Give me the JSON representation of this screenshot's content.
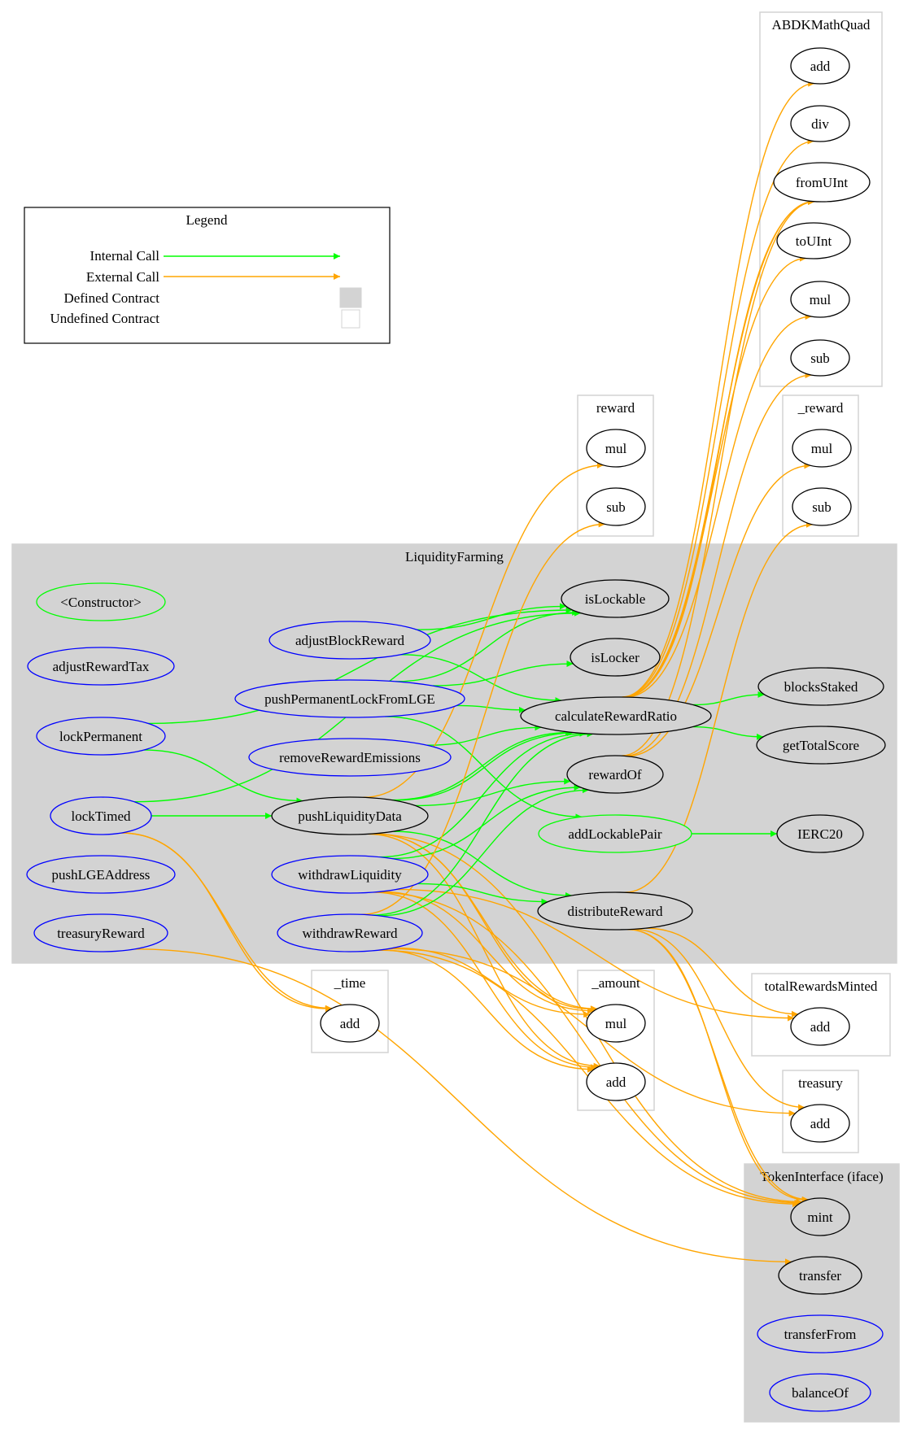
{
  "legend": {
    "title": "Legend",
    "items": [
      {
        "label": "Internal Call",
        "kind": "edge",
        "color": "#00ff00"
      },
      {
        "label": "External Call",
        "kind": "edge",
        "color": "#ffa500"
      },
      {
        "label": "Defined Contract",
        "kind": "swatch",
        "color": "#d3d3d3"
      },
      {
        "label": "Undefined Contract",
        "kind": "swatch",
        "color": "#ffffff"
      }
    ]
  },
  "colors": {
    "internal": "#00ff00",
    "external": "#ffa500",
    "defined_fill": "#d3d3d3",
    "undefined_border": "#d3d3d3",
    "public_node": "#0000ff",
    "internal_node": "#00ff00",
    "plain_node": "#000000"
  },
  "clusters": [
    {
      "id": "ABDKMathQuad",
      "label": "ABDKMathQuad",
      "defined": false
    },
    {
      "id": "reward",
      "label": "reward",
      "defined": false
    },
    {
      "id": "_reward",
      "label": "_reward",
      "defined": false
    },
    {
      "id": "LiquidityFarming",
      "label": "LiquidityFarming",
      "defined": true
    },
    {
      "id": "_time",
      "label": "_time",
      "defined": false
    },
    {
      "id": "_amount",
      "label": "_amount",
      "defined": false
    },
    {
      "id": "totalRewardsMinted",
      "label": "totalRewardsMinted",
      "defined": false
    },
    {
      "id": "treasury",
      "label": "treasury",
      "defined": false
    },
    {
      "id": "TokenInterface",
      "label": "TokenInterface  (iface)",
      "defined": true
    }
  ],
  "nodes": [
    {
      "id": "abdk_add",
      "label": "add",
      "cluster": "ABDKMathQuad",
      "style": "plain"
    },
    {
      "id": "abdk_div",
      "label": "div",
      "cluster": "ABDKMathQuad",
      "style": "plain"
    },
    {
      "id": "abdk_fromUInt",
      "label": "fromUInt",
      "cluster": "ABDKMathQuad",
      "style": "plain"
    },
    {
      "id": "abdk_toUInt",
      "label": "toUInt",
      "cluster": "ABDKMathQuad",
      "style": "plain"
    },
    {
      "id": "abdk_mul",
      "label": "mul",
      "cluster": "ABDKMathQuad",
      "style": "plain"
    },
    {
      "id": "abdk_sub",
      "label": "sub",
      "cluster": "ABDKMathQuad",
      "style": "plain"
    },
    {
      "id": "reward_mul",
      "label": "mul",
      "cluster": "reward",
      "style": "plain"
    },
    {
      "id": "reward_sub",
      "label": "sub",
      "cluster": "reward",
      "style": "plain"
    },
    {
      "id": "_reward_mul",
      "label": "mul",
      "cluster": "_reward",
      "style": "plain"
    },
    {
      "id": "_reward_sub",
      "label": "sub",
      "cluster": "_reward",
      "style": "plain"
    },
    {
      "id": "constructor",
      "label": "<Constructor>",
      "cluster": "LiquidityFarming",
      "style": "internal"
    },
    {
      "id": "adjustRewardTax",
      "label": "adjustRewardTax",
      "cluster": "LiquidityFarming",
      "style": "public"
    },
    {
      "id": "lockPermanent",
      "label": "lockPermanent",
      "cluster": "LiquidityFarming",
      "style": "public"
    },
    {
      "id": "lockTimed",
      "label": "lockTimed",
      "cluster": "LiquidityFarming",
      "style": "public"
    },
    {
      "id": "pushLGEAddress",
      "label": "pushLGEAddress",
      "cluster": "LiquidityFarming",
      "style": "public"
    },
    {
      "id": "treasuryReward",
      "label": "treasuryReward",
      "cluster": "LiquidityFarming",
      "style": "public"
    },
    {
      "id": "adjustBlockReward",
      "label": "adjustBlockReward",
      "cluster": "LiquidityFarming",
      "style": "public"
    },
    {
      "id": "pushPermanentLockFromLGE",
      "label": "pushPermanentLockFromLGE",
      "cluster": "LiquidityFarming",
      "style": "public"
    },
    {
      "id": "removeRewardEmissions",
      "label": "removeRewardEmissions",
      "cluster": "LiquidityFarming",
      "style": "public"
    },
    {
      "id": "pushLiquidityData",
      "label": "pushLiquidityData",
      "cluster": "LiquidityFarming",
      "style": "plain"
    },
    {
      "id": "withdrawLiquidity",
      "label": "withdrawLiquidity",
      "cluster": "LiquidityFarming",
      "style": "public"
    },
    {
      "id": "withdrawReward",
      "label": "withdrawReward",
      "cluster": "LiquidityFarming",
      "style": "public"
    },
    {
      "id": "isLockable",
      "label": "isLockable",
      "cluster": "LiquidityFarming",
      "style": "plain"
    },
    {
      "id": "isLocker",
      "label": "isLocker",
      "cluster": "LiquidityFarming",
      "style": "plain"
    },
    {
      "id": "calculateRewardRatio",
      "label": "calculateRewardRatio",
      "cluster": "LiquidityFarming",
      "style": "plain"
    },
    {
      "id": "rewardOf",
      "label": "rewardOf",
      "cluster": "LiquidityFarming",
      "style": "plain"
    },
    {
      "id": "addLockablePair",
      "label": "addLockablePair",
      "cluster": "LiquidityFarming",
      "style": "internal"
    },
    {
      "id": "distributeReward",
      "label": "distributeReward",
      "cluster": "LiquidityFarming",
      "style": "plain"
    },
    {
      "id": "blocksStaked",
      "label": "blocksStaked",
      "cluster": "LiquidityFarming",
      "style": "plain"
    },
    {
      "id": "getTotalScore",
      "label": "getTotalScore",
      "cluster": "LiquidityFarming",
      "style": "plain"
    },
    {
      "id": "IERC20",
      "label": "IERC20",
      "cluster": "LiquidityFarming",
      "style": "plain"
    },
    {
      "id": "_time_add",
      "label": "add",
      "cluster": "_time",
      "style": "plain"
    },
    {
      "id": "_amount_mul",
      "label": "mul",
      "cluster": "_amount",
      "style": "plain"
    },
    {
      "id": "_amount_add",
      "label": "add",
      "cluster": "_amount",
      "style": "plain"
    },
    {
      "id": "trm_add",
      "label": "add",
      "cluster": "totalRewardsMinted",
      "style": "plain"
    },
    {
      "id": "treasury_add",
      "label": "add",
      "cluster": "treasury",
      "style": "plain"
    },
    {
      "id": "ti_mint",
      "label": "mint",
      "cluster": "TokenInterface",
      "style": "plain"
    },
    {
      "id": "ti_transfer",
      "label": "transfer",
      "cluster": "TokenInterface",
      "style": "plain"
    },
    {
      "id": "ti_transferFrom",
      "label": "transferFrom",
      "cluster": "TokenInterface",
      "style": "public"
    },
    {
      "id": "ti_balanceOf",
      "label": "balanceOf",
      "cluster": "TokenInterface",
      "style": "public"
    }
  ],
  "edges": [
    {
      "from": "lockPermanent",
      "to": "isLockable",
      "type": "internal"
    },
    {
      "from": "lockPermanent",
      "to": "pushLiquidityData",
      "type": "internal"
    },
    {
      "from": "lockTimed",
      "to": "isLockable",
      "type": "internal"
    },
    {
      "from": "lockTimed",
      "to": "pushLiquidityData",
      "type": "internal"
    },
    {
      "from": "lockTimed",
      "to": "_time_add",
      "type": "external"
    },
    {
      "from": "lockTimed",
      "to": "_time_add",
      "type": "external"
    },
    {
      "from": "adjustBlockReward",
      "to": "isLockable",
      "type": "internal"
    },
    {
      "from": "adjustBlockReward",
      "to": "calculateRewardRatio",
      "type": "internal"
    },
    {
      "from": "pushPermanentLockFromLGE",
      "to": "isLockable",
      "type": "internal"
    },
    {
      "from": "pushPermanentLockFromLGE",
      "to": "isLocker",
      "type": "internal"
    },
    {
      "from": "pushPermanentLockFromLGE",
      "to": "calculateRewardRatio",
      "type": "internal"
    },
    {
      "from": "pushPermanentLockFromLGE",
      "to": "addLockablePair",
      "type": "internal"
    },
    {
      "from": "removeRewardEmissions",
      "to": "calculateRewardRatio",
      "type": "internal"
    },
    {
      "from": "pushLiquidityData",
      "to": "calculateRewardRatio",
      "type": "internal"
    },
    {
      "from": "pushLiquidityData",
      "to": "calculateRewardRatio",
      "type": "internal"
    },
    {
      "from": "pushLiquidityData",
      "to": "rewardOf",
      "type": "internal"
    },
    {
      "from": "pushLiquidityData",
      "to": "distributeReward",
      "type": "internal"
    },
    {
      "from": "pushLiquidityData",
      "to": "reward_mul",
      "type": "external"
    },
    {
      "from": "pushLiquidityData",
      "to": "_amount_mul",
      "type": "external"
    },
    {
      "from": "pushLiquidityData",
      "to": "_amount_mul",
      "type": "external"
    },
    {
      "from": "pushLiquidityData",
      "to": "_amount_add",
      "type": "external"
    },
    {
      "from": "pushLiquidityData",
      "to": "ti_mint",
      "type": "external"
    },
    {
      "from": "withdrawLiquidity",
      "to": "calculateRewardRatio",
      "type": "internal"
    },
    {
      "from": "withdrawLiquidity",
      "to": "rewardOf",
      "type": "internal"
    },
    {
      "from": "withdrawLiquidity",
      "to": "distributeReward",
      "type": "internal"
    },
    {
      "from": "withdrawLiquidity",
      "to": "_amount_mul",
      "type": "external"
    },
    {
      "from": "withdrawLiquidity",
      "to": "_amount_add",
      "type": "external"
    },
    {
      "from": "withdrawLiquidity",
      "to": "ti_mint",
      "type": "external"
    },
    {
      "from": "withdrawLiquidity",
      "to": "trm_add",
      "type": "external"
    },
    {
      "from": "withdrawReward",
      "to": "calculateRewardRatio",
      "type": "internal"
    },
    {
      "from": "withdrawReward",
      "to": "rewardOf",
      "type": "internal"
    },
    {
      "from": "withdrawReward",
      "to": "reward_sub",
      "type": "external"
    },
    {
      "from": "withdrawReward",
      "to": "_amount_mul",
      "type": "external"
    },
    {
      "from": "withdrawReward",
      "to": "_amount_add",
      "type": "external"
    },
    {
      "from": "withdrawReward",
      "to": "ti_mint",
      "type": "external"
    },
    {
      "from": "withdrawReward",
      "to": "treasury_add",
      "type": "external"
    },
    {
      "from": "treasuryReward",
      "to": "ti_transfer",
      "type": "external"
    },
    {
      "from": "calculateRewardRatio",
      "to": "blocksStaked",
      "type": "internal"
    },
    {
      "from": "calculateRewardRatio",
      "to": "getTotalScore",
      "type": "internal"
    },
    {
      "from": "calculateRewardRatio",
      "to": "abdk_add",
      "type": "external"
    },
    {
      "from": "calculateRewardRatio",
      "to": "abdk_div",
      "type": "external"
    },
    {
      "from": "calculateRewardRatio",
      "to": "abdk_fromUInt",
      "type": "external"
    },
    {
      "from": "calculateRewardRatio",
      "to": "abdk_fromUInt",
      "type": "external"
    },
    {
      "from": "calculateRewardRatio",
      "to": "abdk_toUInt",
      "type": "external"
    },
    {
      "from": "calculateRewardRatio",
      "to": "abdk_mul",
      "type": "external"
    },
    {
      "from": "rewardOf",
      "to": "abdk_fromUInt",
      "type": "external"
    },
    {
      "from": "rewardOf",
      "to": "abdk_sub",
      "type": "external"
    },
    {
      "from": "rewardOf",
      "to": "_reward_mul",
      "type": "external"
    },
    {
      "from": "distributeReward",
      "to": "_reward_sub",
      "type": "external"
    },
    {
      "from": "distributeReward",
      "to": "trm_add",
      "type": "external"
    },
    {
      "from": "distributeReward",
      "to": "treasury_add",
      "type": "external"
    },
    {
      "from": "distributeReward",
      "to": "ti_mint",
      "type": "external"
    },
    {
      "from": "distributeReward",
      "to": "ti_mint",
      "type": "external"
    },
    {
      "from": "addLockablePair",
      "to": "IERC20",
      "type": "internal"
    }
  ]
}
